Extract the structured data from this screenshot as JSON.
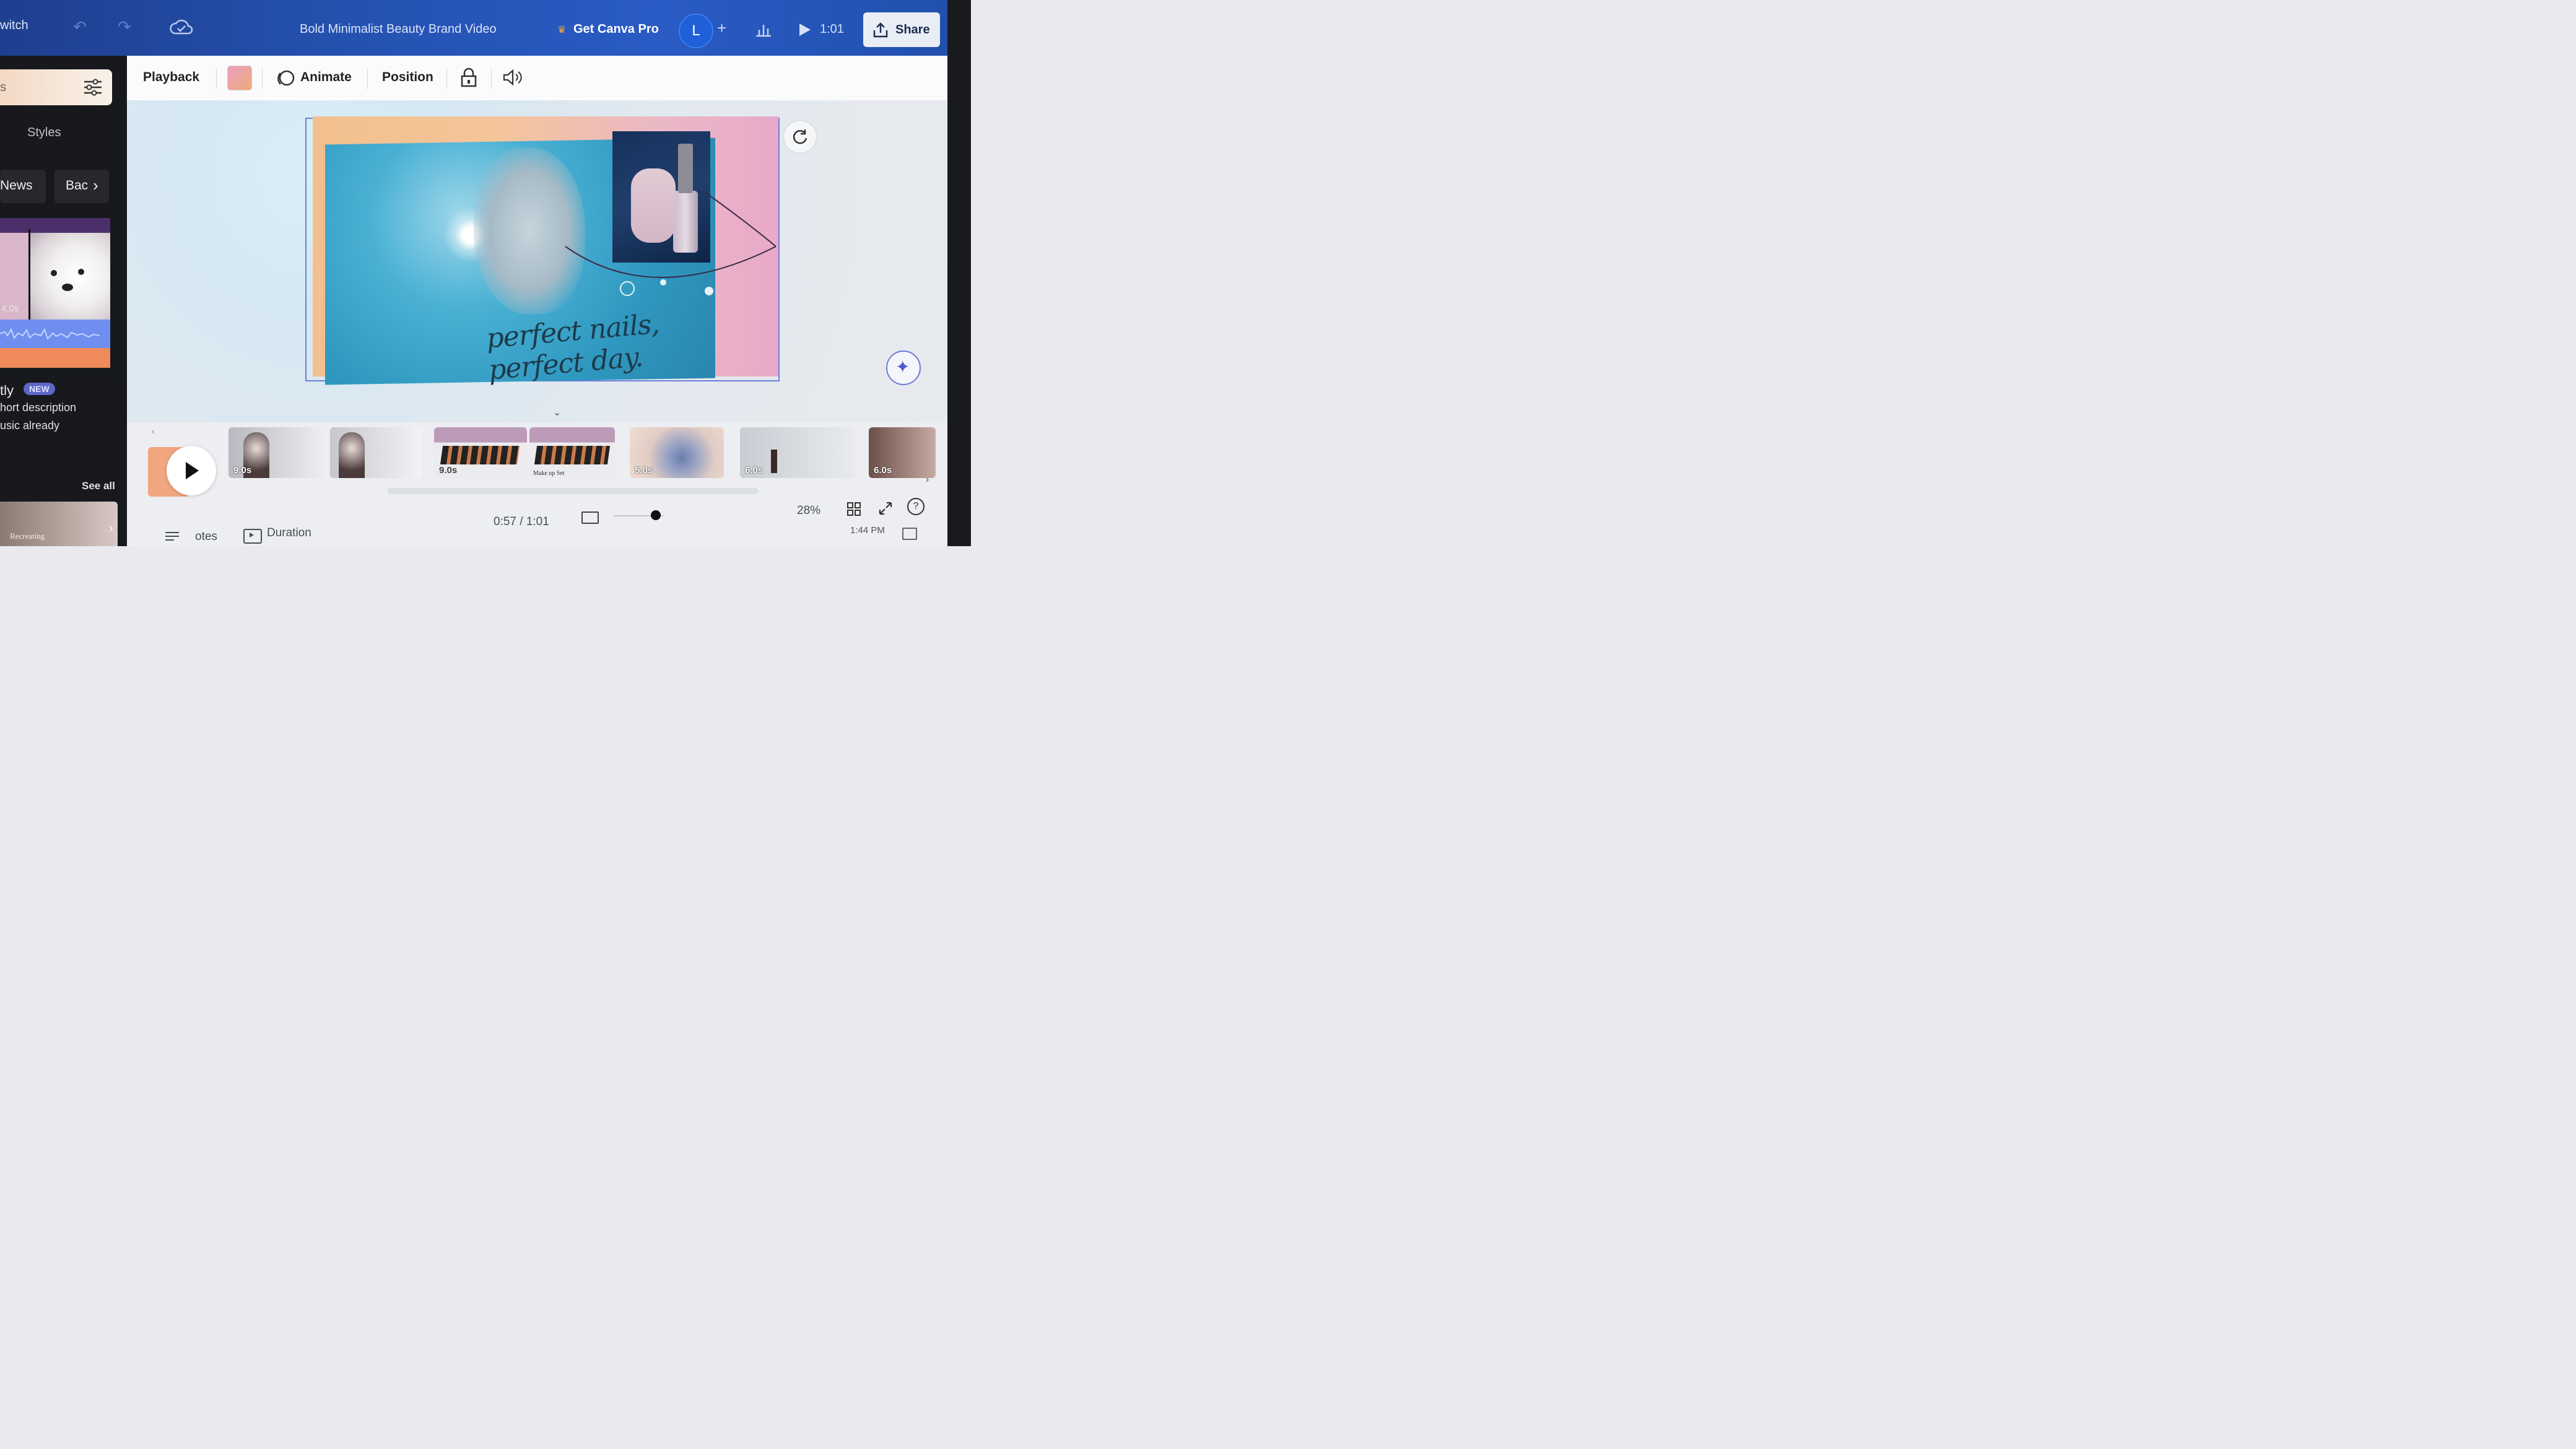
{
  "topbar": {
    "switch_label": "witch",
    "title": "Bold Minimalist Beauty Brand Video",
    "get_pro": "Get Canva Pro",
    "avatar_initial": "L",
    "plus": "+",
    "time": "1:01",
    "share": "Share"
  },
  "sidebar": {
    "search_partial": "s",
    "styles": "Styles",
    "chips": [
      "News",
      "Bac"
    ],
    "clip_duration": "4.0s",
    "feature_name": "tly",
    "badge": "NEW",
    "desc_line1": "hort description",
    "desc_line2": "usic already",
    "see_all": "See all",
    "bottom_card_text": "Recreating"
  },
  "toolbar": {
    "playback": "Playback",
    "animate": "Animate",
    "position": "Position"
  },
  "canvas": {
    "script_text": "perfect nails, perfect day."
  },
  "timeline": {
    "clips": [
      {
        "duration": "9.0s"
      },
      {
        "duration": "9.0s"
      },
      {
        "duration": "5.0s"
      },
      {
        "duration": "6.0s"
      },
      {
        "duration": "6.0s"
      }
    ],
    "clip_caption": "Make up Set",
    "timecode": "0:57 / 1:01",
    "zoom": "28%"
  },
  "bottombar": {
    "notes": "otes",
    "duration": "Duration",
    "clock": "1:44 PM"
  },
  "colors": {
    "topbar": "#2553b3",
    "sidebar": "#17191d",
    "accent_purple": "#7b61ff",
    "canvas_blue": "#3aa0c4",
    "canvas_pink": "#e9a9c9"
  }
}
